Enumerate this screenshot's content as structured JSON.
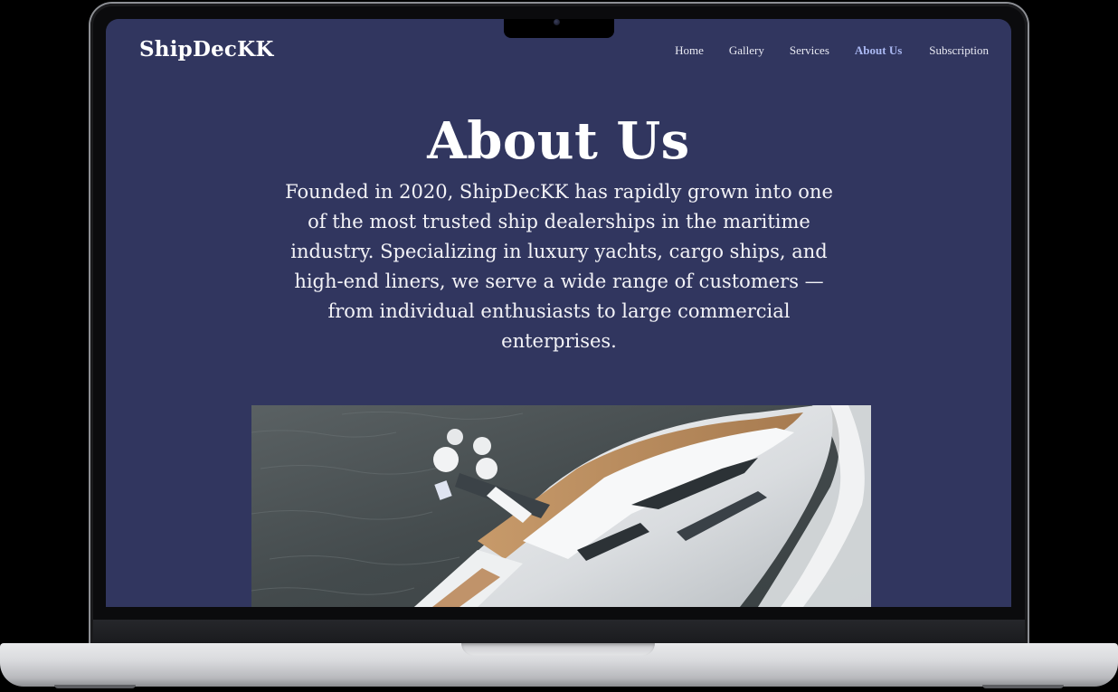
{
  "site": {
    "brand": "ShipDecKK",
    "nav": [
      "Home",
      "Gallery",
      "Services",
      "About Us",
      "Subscription"
    ],
    "active_nav": "About Us",
    "hero": {
      "title": "About Us",
      "text": "Founded in 2020, ShipDecKK has rapidly grown into one of the most trusted ship dealerships in the maritime industry. Specializing in luxury yachts, cargo ships, and high-end liners, we serve a wide range of customers — from individual enthusiasts to large commercial enterprises."
    }
  },
  "colors": {
    "page_background": "#31365f",
    "active_link": "#aab8f2",
    "text": "#ffffff"
  }
}
